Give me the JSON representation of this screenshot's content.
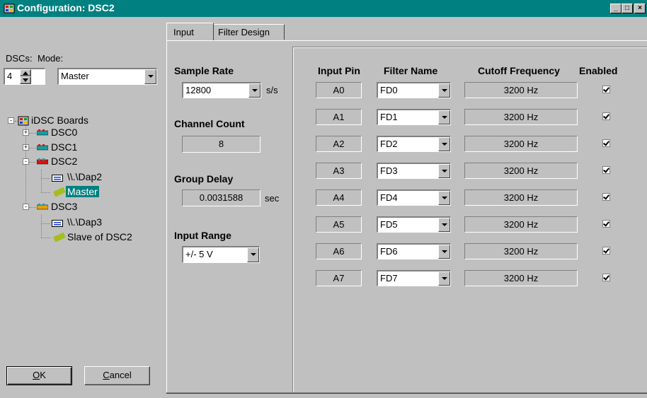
{
  "window": {
    "title": "Configuration: DSC2",
    "icon": "boards-app-icon",
    "controls": [
      "minimize-icon",
      "maximize-icon",
      "close-icon"
    ]
  },
  "left_panel": {
    "dscs_label": "DSCs:",
    "dscs_value": "4",
    "mode_label": "Mode:",
    "mode_value": "Master",
    "tree": {
      "root": "iDSC Boards",
      "nodes": [
        {
          "label": "DSC0",
          "expander": "+"
        },
        {
          "label": "DSC1",
          "expander": "+"
        },
        {
          "label": "DSC2",
          "expander": "-",
          "children": [
            {
              "label": "\\\\.\\Dap2",
              "icon": "dap-icon"
            },
            {
              "label": "Master",
              "icon": "link-icon",
              "selected": true
            }
          ]
        },
        {
          "label": "DSC3",
          "expander": "-",
          "children": [
            {
              "label": "\\\\.\\Dap3",
              "icon": "dap-icon"
            },
            {
              "label": "Slave of DSC2",
              "icon": "link-icon"
            }
          ]
        }
      ]
    },
    "ok_label": "OK",
    "cancel_label": "Cancel"
  },
  "tabs": [
    "Input",
    "Filter Design"
  ],
  "active_tab": "Input",
  "settings": {
    "sample_rate_label": "Sample Rate",
    "sample_rate_value": "12800",
    "sample_rate_unit": "s/s",
    "channel_count_label": "Channel Count",
    "channel_count_value": "8",
    "group_delay_label": "Group Delay",
    "group_delay_value": "0.0031588",
    "group_delay_unit": "sec",
    "input_range_label": "Input Range",
    "input_range_value": "+/- 5 V"
  },
  "channels": {
    "headers": [
      "Input Pin",
      "Filter Name",
      "Cutoff Frequency",
      "Enabled"
    ],
    "rows": [
      {
        "pin": "A0",
        "filter": "FD0",
        "cutoff": "3200 Hz",
        "enabled": true
      },
      {
        "pin": "A1",
        "filter": "FD1",
        "cutoff": "3200 Hz",
        "enabled": true
      },
      {
        "pin": "A2",
        "filter": "FD2",
        "cutoff": "3200 Hz",
        "enabled": true
      },
      {
        "pin": "A3",
        "filter": "FD3",
        "cutoff": "3200 Hz",
        "enabled": true
      },
      {
        "pin": "A4",
        "filter": "FD4",
        "cutoff": "3200 Hz",
        "enabled": true
      },
      {
        "pin": "A5",
        "filter": "FD5",
        "cutoff": "3200 Hz",
        "enabled": true
      },
      {
        "pin": "A6",
        "filter": "FD6",
        "cutoff": "3200 Hz",
        "enabled": true
      },
      {
        "pin": "A7",
        "filter": "FD7",
        "cutoff": "3200 Hz",
        "enabled": true
      }
    ]
  }
}
